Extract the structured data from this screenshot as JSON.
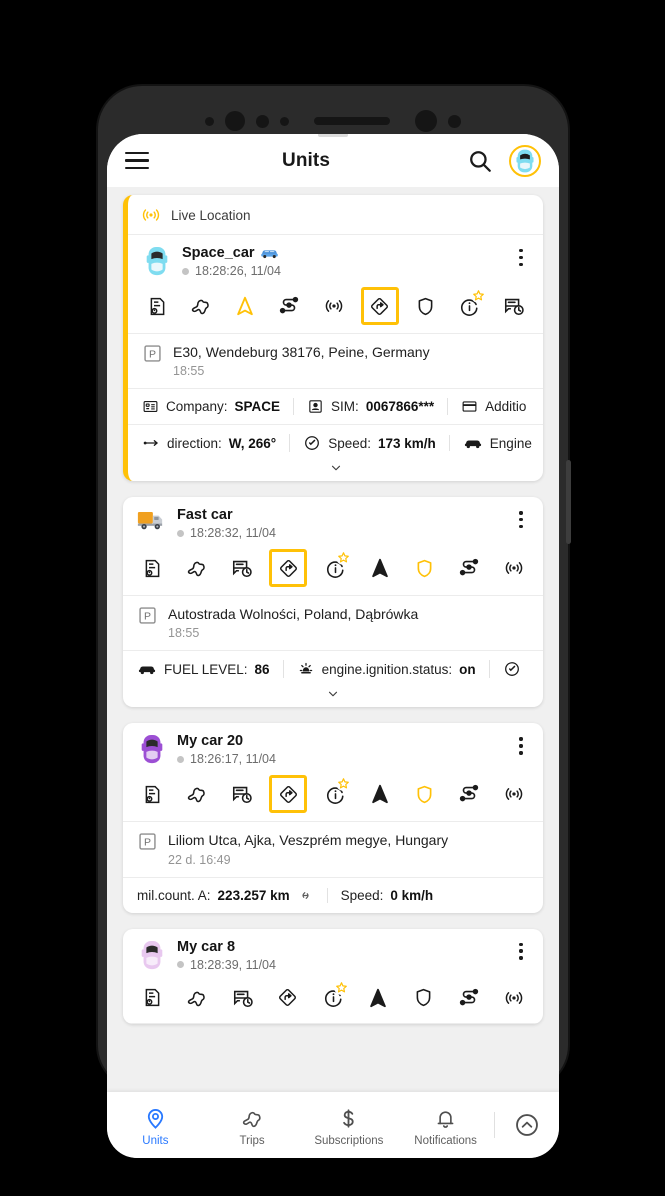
{
  "app": {
    "title": "Units",
    "menu_icon": "hamburger-menu-icon",
    "search_icon": "search-icon",
    "avatar_icon": "car-avatar-icon"
  },
  "live_location": {
    "label": "Live Location",
    "icon": "live-broadcast-icon"
  },
  "units": [
    {
      "name": "Space_car",
      "name_emoji": "blue-car-emoji",
      "avatar": "cyan-car-emoji",
      "time": "18:28:26, 11/04",
      "accented": true,
      "icons": [
        {
          "name": "report-icon",
          "selected": false,
          "star": false,
          "color": "#1b1b1b"
        },
        {
          "name": "track-route-icon",
          "selected": false,
          "star": false,
          "color": "#1b1b1b"
        },
        {
          "name": "navigation-arrow-icon",
          "selected": false,
          "star": false,
          "color": "#ffc107"
        },
        {
          "name": "waypoints-icon",
          "selected": false,
          "star": false,
          "color": "#1b1b1b"
        },
        {
          "name": "live-broadcast-icon",
          "selected": false,
          "star": false,
          "color": "#1b1b1b"
        },
        {
          "name": "directions-sign-icon",
          "selected": true,
          "star": false,
          "color": "#1b1b1b"
        },
        {
          "name": "shield-icon",
          "selected": false,
          "star": false,
          "color": "#1b1b1b"
        },
        {
          "name": "info-icon",
          "selected": false,
          "star": true,
          "color": "#1b1b1b"
        },
        {
          "name": "history-card-icon",
          "selected": false,
          "star": false,
          "color": "#1b1b1b"
        }
      ],
      "address": "E30, Wendeburg 38176, Peine, Germany",
      "address_time": "18:55",
      "stat_rows": [
        [
          {
            "icon": "company-icon",
            "label": "Company:",
            "value": "SPACE"
          },
          {
            "icon": "sim-card-icon",
            "label": "SIM:",
            "value": "0067866***"
          },
          {
            "icon": "credit-card-icon",
            "label": "Additio",
            "value": ""
          }
        ],
        [
          {
            "icon": "direction-arrow-icon",
            "label": "direction:",
            "value": "W, 266°"
          },
          {
            "icon": "speedometer-icon",
            "label": "Speed:",
            "value": "173 km/h"
          },
          {
            "icon": "car-icon",
            "label": "Engine",
            "value": ""
          }
        ]
      ],
      "has_chevron": true
    },
    {
      "name": "Fast car",
      "name_emoji": "",
      "avatar": "orange-truck-emoji",
      "time": "18:28:32, 11/04",
      "accented": false,
      "icons": [
        {
          "name": "report-icon",
          "selected": false,
          "star": false,
          "color": "#1b1b1b"
        },
        {
          "name": "track-route-icon",
          "selected": false,
          "star": false,
          "color": "#1b1b1b"
        },
        {
          "name": "history-card-icon",
          "selected": false,
          "star": false,
          "color": "#1b1b1b"
        },
        {
          "name": "directions-sign-icon",
          "selected": true,
          "star": false,
          "color": "#1b1b1b"
        },
        {
          "name": "info-icon",
          "selected": false,
          "star": true,
          "color": "#1b1b1b"
        },
        {
          "name": "navigation-arrow-icon",
          "selected": false,
          "star": false,
          "color": "#1b1b1b"
        },
        {
          "name": "shield-icon",
          "selected": false,
          "star": false,
          "color": "#ffc107"
        },
        {
          "name": "waypoints-icon",
          "selected": false,
          "star": false,
          "color": "#1b1b1b"
        },
        {
          "name": "live-broadcast-icon",
          "selected": false,
          "star": false,
          "color": "#1b1b1b"
        }
      ],
      "address": "Autostrada Wolności, Poland, Dąbrówka",
      "address_time": "18:55",
      "stat_rows": [
        [
          {
            "icon": "car-icon",
            "label": "FUEL LEVEL:",
            "value": "86"
          },
          {
            "icon": "ignition-icon",
            "label": "engine.ignition.status:",
            "value": "on"
          },
          {
            "icon": "speedometer-icon",
            "label": "",
            "value": ""
          }
        ]
      ],
      "has_chevron": true
    },
    {
      "name": "My car 20",
      "name_emoji": "",
      "avatar": "purple-car-emoji",
      "time": "18:26:17, 11/04",
      "accented": false,
      "icons": [
        {
          "name": "report-icon",
          "selected": false,
          "star": false,
          "color": "#1b1b1b"
        },
        {
          "name": "track-route-icon",
          "selected": false,
          "star": false,
          "color": "#1b1b1b"
        },
        {
          "name": "history-card-icon",
          "selected": false,
          "star": false,
          "color": "#1b1b1b"
        },
        {
          "name": "directions-sign-icon",
          "selected": true,
          "star": false,
          "color": "#1b1b1b"
        },
        {
          "name": "info-icon",
          "selected": false,
          "star": true,
          "color": "#1b1b1b"
        },
        {
          "name": "navigation-arrow-icon",
          "selected": false,
          "star": false,
          "color": "#1b1b1b"
        },
        {
          "name": "shield-icon",
          "selected": false,
          "star": false,
          "color": "#ffc107"
        },
        {
          "name": "waypoints-icon",
          "selected": false,
          "star": false,
          "color": "#1b1b1b"
        },
        {
          "name": "live-broadcast-icon",
          "selected": false,
          "star": false,
          "color": "#1b1b1b"
        }
      ],
      "address": "Liliom Utca, Ajka, Veszprém megye, Hungary",
      "address_time": "22 d. 16:49",
      "stat_rows": [
        [
          {
            "icon": "link-icon",
            "label": "mil.count. A:",
            "value": "223.257 km"
          },
          {
            "icon": "",
            "label": "Speed:",
            "value": "0 km/h"
          }
        ]
      ],
      "has_chevron": false
    },
    {
      "name": "My car 8",
      "name_emoji": "",
      "avatar": "pink-car-emoji",
      "time": "18:28:39, 11/04",
      "accented": false,
      "icons": [
        {
          "name": "report-icon",
          "selected": false,
          "star": false,
          "color": "#1b1b1b"
        },
        {
          "name": "track-route-icon",
          "selected": false,
          "star": false,
          "color": "#1b1b1b"
        },
        {
          "name": "history-card-icon",
          "selected": false,
          "star": false,
          "color": "#1b1b1b"
        },
        {
          "name": "directions-sign-icon",
          "selected": false,
          "star": false,
          "color": "#1b1b1b"
        },
        {
          "name": "info-icon",
          "selected": false,
          "star": true,
          "color": "#1b1b1b"
        },
        {
          "name": "navigation-arrow-icon",
          "selected": false,
          "star": false,
          "color": "#1b1b1b"
        },
        {
          "name": "shield-icon",
          "selected": false,
          "star": false,
          "color": "#1b1b1b"
        },
        {
          "name": "waypoints-icon",
          "selected": false,
          "star": false,
          "color": "#1b1b1b"
        },
        {
          "name": "live-broadcast-icon",
          "selected": false,
          "star": false,
          "color": "#1b1b1b"
        }
      ],
      "address": "",
      "address_time": "",
      "stat_rows": [],
      "has_chevron": false
    }
  ],
  "bottom_nav": {
    "items": [
      {
        "label": "Units",
        "icon": "location-pin-icon",
        "active": true
      },
      {
        "label": "Trips",
        "icon": "track-route-icon",
        "active": false
      },
      {
        "label": "Subscriptions",
        "icon": "dollar-icon",
        "active": false
      },
      {
        "label": "Notifications",
        "icon": "bell-icon",
        "active": false
      }
    ],
    "expand_icon": "chevron-up-circle-icon"
  },
  "colors": {
    "accent": "#ffc107",
    "active_nav": "#2979ff",
    "background": "#f0f0f0",
    "card": "#ffffff"
  }
}
